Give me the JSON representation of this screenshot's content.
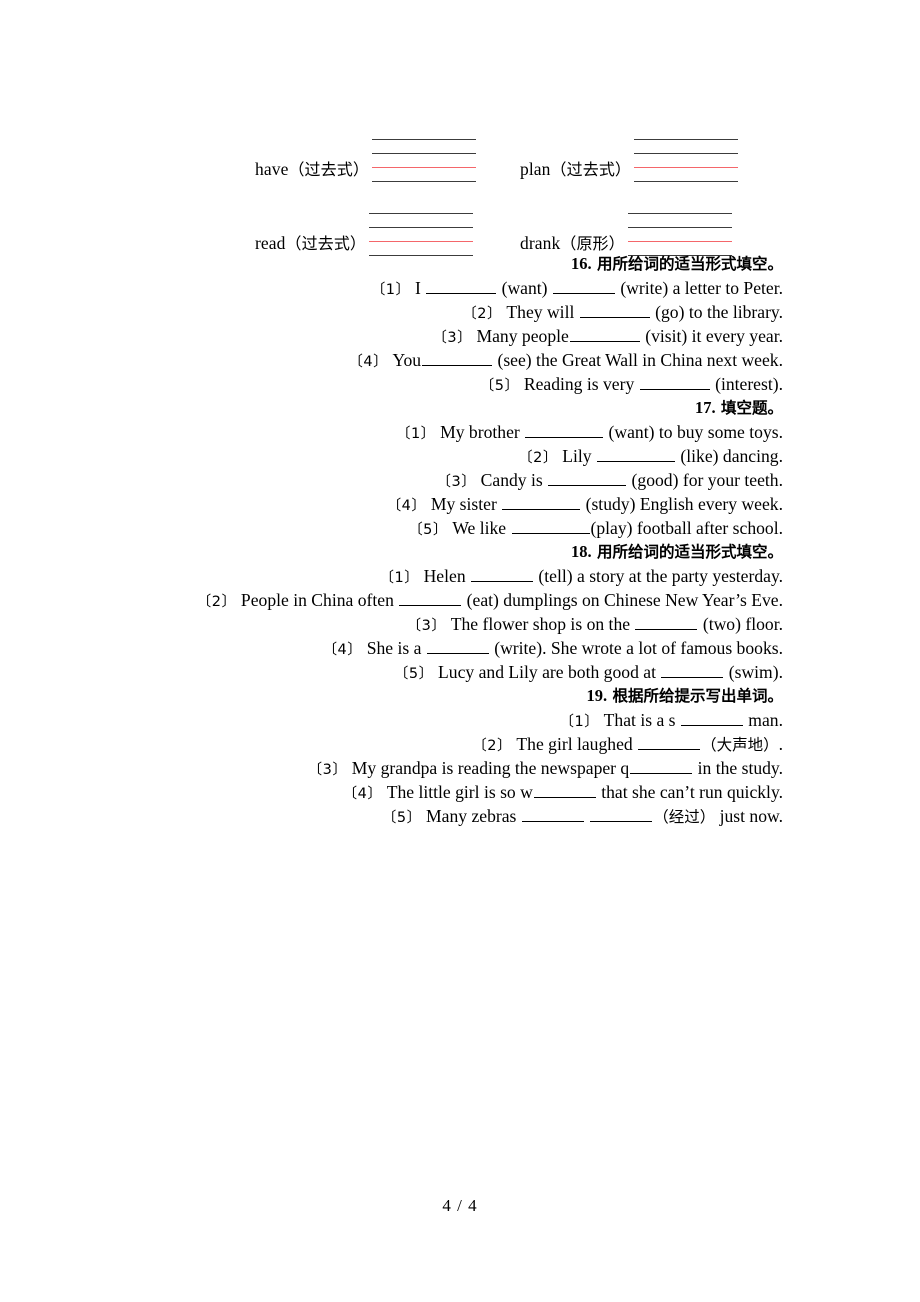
{
  "handwriting": {
    "rows": [
      {
        "cells": [
          {
            "word": "have",
            "hint": "（过去式）"
          },
          {
            "word": "plan",
            "hint": "（过去式）"
          }
        ]
      },
      {
        "cells": [
          {
            "word": "read",
            "hint": "（过去式）"
          },
          {
            "word": "drank",
            "hint": "（原形）"
          }
        ]
      }
    ]
  },
  "sections": [
    {
      "number": "16.",
      "title": "用所给词的适当形式填空。",
      "items": [
        {
          "label": "〔1〕",
          "parts": [
            {
              "t": "text",
              "v": " I "
            },
            {
              "t": "blank",
              "w": "w1"
            },
            {
              "t": "text",
              "v": " (want) "
            },
            {
              "t": "blank",
              "w": "w2"
            },
            {
              "t": "text",
              "v": " (write) a letter to Peter."
            }
          ]
        },
        {
          "label": "〔2〕",
          "parts": [
            {
              "t": "text",
              "v": " They will "
            },
            {
              "t": "blank",
              "w": "w1"
            },
            {
              "t": "text",
              "v": " (go) to the library."
            }
          ]
        },
        {
          "label": "〔3〕",
          "parts": [
            {
              "t": "text",
              "v": " Many people"
            },
            {
              "t": "blank",
              "w": "w1"
            },
            {
              "t": "text",
              "v": " (visit) it every year."
            }
          ]
        },
        {
          "label": "〔4〕",
          "parts": [
            {
              "t": "text",
              "v": " You"
            },
            {
              "t": "blank",
              "w": "w1"
            },
            {
              "t": "text",
              "v": " (see) the Great Wall in China next week."
            }
          ]
        },
        {
          "label": "〔5〕",
          "parts": [
            {
              "t": "text",
              "v": " Reading is very "
            },
            {
              "t": "blank",
              "w": "w1"
            },
            {
              "t": "text",
              "v": " (interest)."
            }
          ]
        }
      ]
    },
    {
      "number": "17.",
      "title": "填空题。",
      "items": [
        {
          "label": "〔1〕",
          "parts": [
            {
              "t": "text",
              "v": " My brother "
            },
            {
              "t": "blank",
              "w": "w3"
            },
            {
              "t": "text",
              "v": " (want) to buy some toys."
            }
          ]
        },
        {
          "label": "〔2〕",
          "parts": [
            {
              "t": "text",
              "v": " Lily "
            },
            {
              "t": "blank",
              "w": "w3"
            },
            {
              "t": "text",
              "v": " (like) dancing."
            }
          ]
        },
        {
          "label": "〔3〕",
          "parts": [
            {
              "t": "text",
              "v": " Candy is "
            },
            {
              "t": "blank",
              "w": "w3"
            },
            {
              "t": "text",
              "v": " (good) for your teeth."
            }
          ]
        },
        {
          "label": "〔4〕",
          "parts": [
            {
              "t": "text",
              "v": " My sister "
            },
            {
              "t": "blank",
              "w": "w3"
            },
            {
              "t": "text",
              "v": " (study) English every week."
            }
          ]
        },
        {
          "label": "〔5〕",
          "parts": [
            {
              "t": "text",
              "v": " We like "
            },
            {
              "t": "blank",
              "w": "w3"
            },
            {
              "t": "text",
              "v": "(play) football after school."
            }
          ]
        }
      ]
    },
    {
      "number": "18.",
      "title": "用所给词的适当形式填空。",
      "items": [
        {
          "label": "〔1〕",
          "parts": [
            {
              "t": "text",
              "v": " Helen "
            },
            {
              "t": "blank",
              "w": "w2"
            },
            {
              "t": "text",
              "v": " (tell) a story at the party yesterday."
            }
          ]
        },
        {
          "label": "〔2〕",
          "parts": [
            {
              "t": "text",
              "v": " People in China often "
            },
            {
              "t": "blank",
              "w": "w2"
            },
            {
              "t": "text",
              "v": " (eat) dumplings on Chinese New Year’s Eve."
            }
          ]
        },
        {
          "label": "〔3〕",
          "parts": [
            {
              "t": "text",
              "v": " The flower shop is on the "
            },
            {
              "t": "blank",
              "w": "w2"
            },
            {
              "t": "text",
              "v": " (two) floor."
            }
          ]
        },
        {
          "label": "〔4〕",
          "parts": [
            {
              "t": "text",
              "v": " She is a "
            },
            {
              "t": "blank",
              "w": "w2"
            },
            {
              "t": "text",
              "v": " (write). She wrote a lot of famous books."
            }
          ]
        },
        {
          "label": "〔5〕",
          "parts": [
            {
              "t": "text",
              "v": " Lucy and Lily are both good at "
            },
            {
              "t": "blank",
              "w": "w2"
            },
            {
              "t": "text",
              "v": " (swim)."
            }
          ]
        }
      ]
    },
    {
      "number": "19.",
      "title": "根据所给提示写出单词。",
      "items": [
        {
          "label": "〔1〕",
          "parts": [
            {
              "t": "text",
              "v": " That is a s "
            },
            {
              "t": "blank",
              "w": "w2"
            },
            {
              "t": "text",
              "v": " man."
            }
          ]
        },
        {
          "label": "〔2〕",
          "parts": [
            {
              "t": "text",
              "v": " The girl laughed "
            },
            {
              "t": "blank",
              "w": "w2"
            },
            {
              "t": "cn",
              "v": "（大声地）"
            },
            {
              "t": "text",
              "v": "."
            }
          ]
        },
        {
          "label": "〔3〕",
          "parts": [
            {
              "t": "text",
              "v": " My grandpa is reading the newspaper q"
            },
            {
              "t": "blank",
              "w": "w2"
            },
            {
              "t": "text",
              "v": " in the study."
            }
          ]
        },
        {
          "label": "〔4〕",
          "parts": [
            {
              "t": "text",
              "v": " The little girl is so w"
            },
            {
              "t": "blank",
              "w": "w2"
            },
            {
              "t": "text",
              "v": " that she can’t run quickly."
            }
          ]
        },
        {
          "label": "〔5〕",
          "parts": [
            {
              "t": "text",
              "v": " Many zebras "
            },
            {
              "t": "blank",
              "w": "w2"
            },
            {
              "t": "text",
              "v": " "
            },
            {
              "t": "blank",
              "w": "w2"
            },
            {
              "t": "cn",
              "v": "（经过）"
            },
            {
              "t": "text",
              "v": " just now."
            }
          ]
        }
      ]
    }
  ],
  "footer": {
    "page_indicator": "4 / 4"
  },
  "colors": {
    "rule_dark": "#3c3c3c",
    "rule_red": "#f4666a",
    "text": "#000000"
  }
}
